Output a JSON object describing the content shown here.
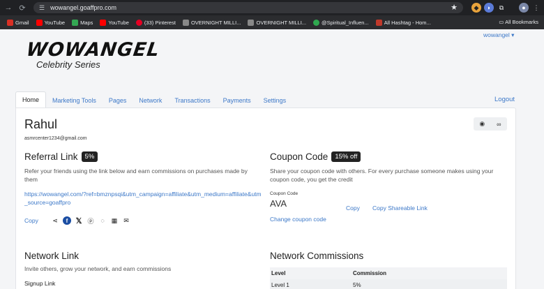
{
  "browser": {
    "url": "wowangel.goaffpro.com",
    "bookmarks": [
      "Gmail",
      "YouTube",
      "Maps",
      "YouTube",
      "(33) Pinterest",
      "OVERNIGHT MILLI...",
      "OVERNIGHT MILLI...",
      "@Spiritual_Influen...",
      "All Hashtag - Hom..."
    ],
    "all_bookmarks": "All Bookmarks"
  },
  "header": {
    "user_menu": "wowangel ▾",
    "logo_main": "WOWANGEL",
    "logo_sub": "Celebrity Series"
  },
  "tabs": [
    "Home",
    "Marketing Tools",
    "Pages",
    "Network",
    "Transactions",
    "Payments",
    "Settings"
  ],
  "logout": "Logout",
  "profile": {
    "name": "Rahul",
    "email": "asmrcenter1234@gmail.com"
  },
  "referral": {
    "title": "Referral Link",
    "badge": "5%",
    "description": "Refer your friends using the link below and earn commissions on purchases made by them",
    "link": "https://wowangel.com/?ref=bmznpsqi&utm_campaign=affiliate&utm_medium=affiliate&utm_source=goaffpro",
    "copy": "Copy"
  },
  "coupon": {
    "title": "Coupon Code",
    "badge": "15% off",
    "description": "Share your coupon code with others. For every purchase someone makes using your coupon code, you get the credit",
    "code_label": "Coupon Code",
    "code": "AVA",
    "copy": "Copy",
    "copy_link": "Copy Shareable Link",
    "change": "Change coupon code"
  },
  "network": {
    "title": "Network Link",
    "description": "Invite others, grow your network, and earn commissions",
    "signup_label": "Signup Link"
  },
  "network_commissions": {
    "title": "Network Commissions",
    "headers": [
      "Level",
      "Commission"
    ],
    "rows": [
      [
        "Level 1",
        "5%"
      ]
    ]
  }
}
